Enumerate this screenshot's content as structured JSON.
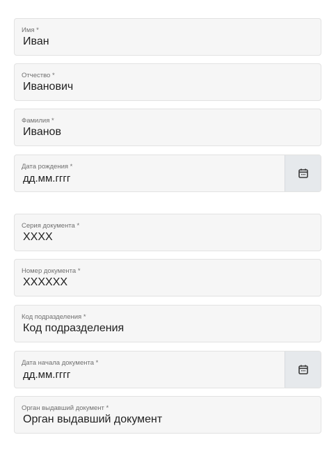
{
  "fields": {
    "first_name": {
      "label": "Имя *",
      "value": "Иван"
    },
    "patronymic": {
      "label": "Отчество *",
      "value": "Иванович"
    },
    "last_name": {
      "label": "Фамилия *",
      "value": "Иванов"
    },
    "birth_date": {
      "label": "Дата рождения *",
      "value": "дд.мм.гггг",
      "icon": "calendar-icon"
    },
    "doc_series": {
      "label": "Серия документа *",
      "value": "XXXX"
    },
    "doc_number": {
      "label": "Номер документа *",
      "value": "XXXXXX"
    },
    "division_code": {
      "label": "Код подразделения *",
      "value": "Код подразделения"
    },
    "doc_start_date": {
      "label": "Дата начала документа *",
      "value": "дд.мм.гггг",
      "icon": "calendar-icon"
    },
    "issuing_authority": {
      "label": "Орган выдавший документ *",
      "value": "Орган выдавший документ"
    }
  }
}
